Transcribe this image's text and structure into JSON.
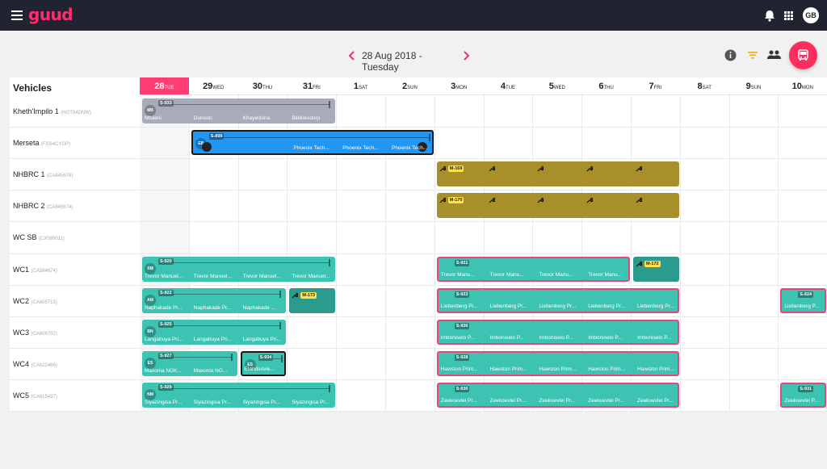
{
  "topbar": {
    "logo": "guud",
    "user_initials": "GB",
    "icons": [
      "menu-icon",
      "bell-icon",
      "apps-grid-icon"
    ]
  },
  "datebar": {
    "date": "28 Aug 2018 - Tuesday"
  },
  "toolbar": {
    "icons": [
      "info-icon",
      "filter-icon",
      "people-icon",
      "bus-icon"
    ],
    "accent": "#ff2d5f",
    "filter_color": "#f5a623"
  },
  "board": {
    "vehicles_label": "Vehicles",
    "days": [
      {
        "num": "28",
        "wd": "TUE",
        "today": true
      },
      {
        "num": "29",
        "wd": "WED"
      },
      {
        "num": "30",
        "wd": "THU"
      },
      {
        "num": "31",
        "wd": "FRI"
      },
      {
        "num": "1",
        "wd": "SAT"
      },
      {
        "num": "2",
        "wd": "SUN"
      },
      {
        "num": "3",
        "wd": "MON"
      },
      {
        "num": "4",
        "wd": "TUE"
      },
      {
        "num": "5",
        "wd": "WED"
      },
      {
        "num": "6",
        "wd": "THU"
      },
      {
        "num": "7",
        "wd": "FRI"
      },
      {
        "num": "8",
        "wd": "SAT"
      },
      {
        "num": "9",
        "wd": "SUN"
      },
      {
        "num": "10",
        "wd": "MON"
      }
    ],
    "rows": [
      {
        "name": "Kheth'Impilo 1",
        "plate": "(HGT94DNW)"
      },
      {
        "name": "Merseta",
        "plate": "(FSS4CYGP)"
      },
      {
        "name": "NHBRC 1",
        "plate": "(CA845676)"
      },
      {
        "name": "NHBRC 2",
        "plate": "(CA845674)"
      },
      {
        "name": "WC SB",
        "plate": "(CX089011)"
      },
      {
        "name": "WC1",
        "plate": "(CA594674)"
      },
      {
        "name": "WC2",
        "plate": "(CA605715)"
      },
      {
        "name": "WC3",
        "plate": "(CA606792)"
      },
      {
        "name": "WC4",
        "plate": "(CA622466)"
      },
      {
        "name": "WC5",
        "plate": "(CA615437)"
      }
    ],
    "bookings": [
      {
        "row": 0,
        "start": 0,
        "span": 4,
        "style": "gray",
        "initials": "MB",
        "code": "S-933",
        "labels": [
          "Mfuleni",
          "Dunoon",
          "Khayelitsha",
          "Blikkiesdorp"
        ]
      },
      {
        "row": 1,
        "start": 1,
        "span": 5,
        "style": "blue",
        "initials": "EB",
        "code": "S-899",
        "labels": [
          "",
          "",
          "Phoenix Tech...",
          "Phoenix Tech...",
          "Phoenix Tech..."
        ]
      },
      {
        "row": 2,
        "start": 6,
        "span": 5,
        "style": "olive",
        "code": "M-169",
        "wrench": true
      },
      {
        "row": 3,
        "start": 6,
        "span": 5,
        "style": "olive",
        "code": "M-170",
        "wrench": true
      },
      {
        "row": 5,
        "start": 0,
        "span": 4,
        "style": "teal",
        "initials": "XM",
        "code": "S-920",
        "labels": [
          "Trevor Manuel...",
          "Trevor Manuel...",
          "Trevor Manuel...",
          "Trevor Manuel..."
        ]
      },
      {
        "row": 5,
        "start": 6,
        "span": 4,
        "style": "teal pink",
        "code": "S-921",
        "labels": [
          "Trevor Manu...",
          "Trevor Manu...",
          "Trevor Manu...",
          "Trevor Manu..."
        ]
      },
      {
        "row": 5,
        "start": 10,
        "span": 1,
        "style": "dteal",
        "code": "M-172",
        "wrench": true
      },
      {
        "row": 6,
        "start": 0,
        "span": 3,
        "style": "teal",
        "initials": "AM",
        "code": "S-922",
        "labels": [
          "Naphakade Pr...",
          "Naphakade Pr...",
          "Naphakade ..."
        ]
      },
      {
        "row": 6,
        "start": 3,
        "span": 1,
        "style": "dteal",
        "code": "M-173",
        "wrench": true
      },
      {
        "row": 6,
        "start": 6,
        "span": 5,
        "style": "teal pink",
        "code": "S-923",
        "labels": [
          "Liebenberg Pr...",
          "Liebenberg Pr...",
          "Liebenberg Pr...",
          "Liebenberg Pr...",
          "Liebenberg Pr..."
        ]
      },
      {
        "row": 6,
        "start": 13,
        "span": 1,
        "style": "teal pink",
        "code": "S-924",
        "labels": [
          "Liebenberg P..."
        ]
      },
      {
        "row": 7,
        "start": 0,
        "span": 3,
        "style": "teal",
        "initials": "BN",
        "code": "S-925",
        "labels": [
          "Langabuya Pri...",
          "Langabuya Pri...",
          "Langabuya Pri..."
        ]
      },
      {
        "row": 7,
        "start": 6,
        "span": 5,
        "style": "teal pink",
        "code": "S-926",
        "labels": [
          "Imboniselo P...",
          "Imboniselo P...",
          "Imboniselo P...",
          "Imboniselo P...",
          "Imboniselo P..."
        ]
      },
      {
        "row": 8,
        "start": 0,
        "span": 2,
        "style": "teal",
        "initials": "ES",
        "code": "S-927",
        "labels": [
          "Maxonia NGK...",
          "Maxonia NG..."
        ]
      },
      {
        "row": 8,
        "start": 2,
        "span": 1,
        "style": "teal sel",
        "initials": "ES",
        "code": "S-934",
        "labels": [
          "Elandsrivie..."
        ]
      },
      {
        "row": 8,
        "start": 6,
        "span": 5,
        "style": "teal pink",
        "code": "S-928",
        "labels": [
          "Hawston Prim...",
          "Hawston Prim...",
          "Hawston Prim...",
          "Hawston Prim...",
          "Hawston Prim..."
        ]
      },
      {
        "row": 9,
        "start": 0,
        "span": 4,
        "style": "teal",
        "initials": "NM",
        "code": "S-929",
        "labels": [
          "Siyazingisa Pr...",
          "Siyazingisa Pr...",
          "Siyazingisa Pr...",
          "Siyazingisa Pr..."
        ]
      },
      {
        "row": 9,
        "start": 6,
        "span": 5,
        "style": "teal pink",
        "code": "S-930",
        "labels": [
          "Zeekoevlei Pr...",
          "Zeekoevlei Pr...",
          "Zeekoevlei Pr...",
          "Zeekoevlei Pr...",
          "Zeekoevlei Pr..."
        ]
      },
      {
        "row": 9,
        "start": 13,
        "span": 1,
        "style": "teal pink",
        "code": "S-931",
        "labels": [
          "Zeekoevlei P..."
        ]
      }
    ]
  }
}
